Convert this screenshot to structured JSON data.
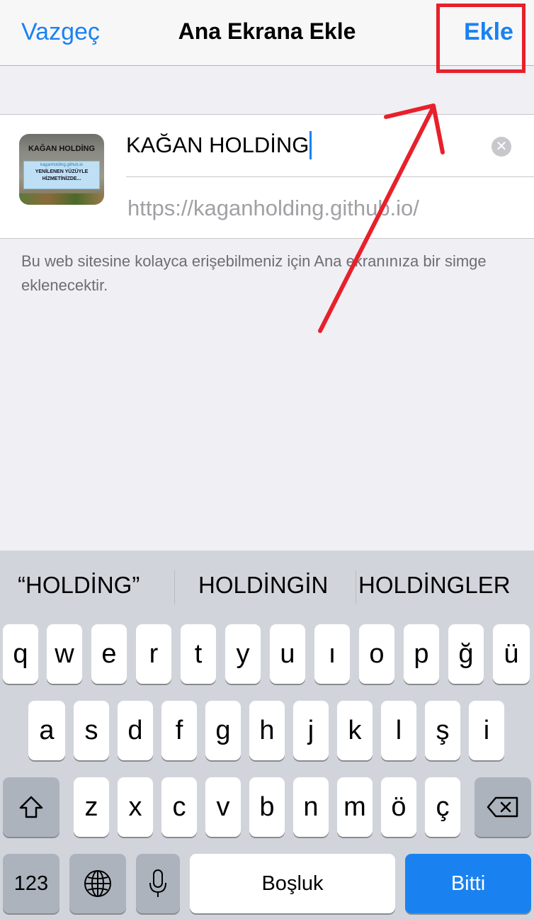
{
  "nav": {
    "cancel_label": "Vazgeç",
    "title": "Ana Ekrana Ekle",
    "add_label": "Ekle"
  },
  "bookmark": {
    "name_value": "KAĞAN HOLDİNG",
    "url": "https://kaganholding.github.io/",
    "thumbnail": {
      "title": "KAĞAN HOLDİNG",
      "url_text": "kaganholding.github.io",
      "line1": "YENİLENEN YÜZÜYLE",
      "line2": "HİZMETİNİZDE..."
    }
  },
  "footnote": "Bu web sitesine kolayca erişebilmeniz için Ana ekranınıza bir simge eklenecektir.",
  "keyboard": {
    "suggestions": [
      "“HOLDİNG”",
      "HOLDİNGİN",
      "HOLDİNGLER"
    ],
    "row1": [
      "q",
      "w",
      "e",
      "r",
      "t",
      "y",
      "u",
      "ı",
      "o",
      "p",
      "ğ",
      "ü"
    ],
    "row2": [
      "a",
      "s",
      "d",
      "f",
      "g",
      "h",
      "j",
      "k",
      "l",
      "ş",
      "i"
    ],
    "row3": [
      "z",
      "x",
      "c",
      "v",
      "b",
      "n",
      "m",
      "ö",
      "ç"
    ],
    "numbers_label": "123",
    "space_label": "Boşluk",
    "done_label": "Bitti"
  },
  "colors": {
    "accent": "#1a82f0",
    "annotation": "#e8202a",
    "background": "#efeff4",
    "keyboard_bg": "#d1d5db"
  }
}
